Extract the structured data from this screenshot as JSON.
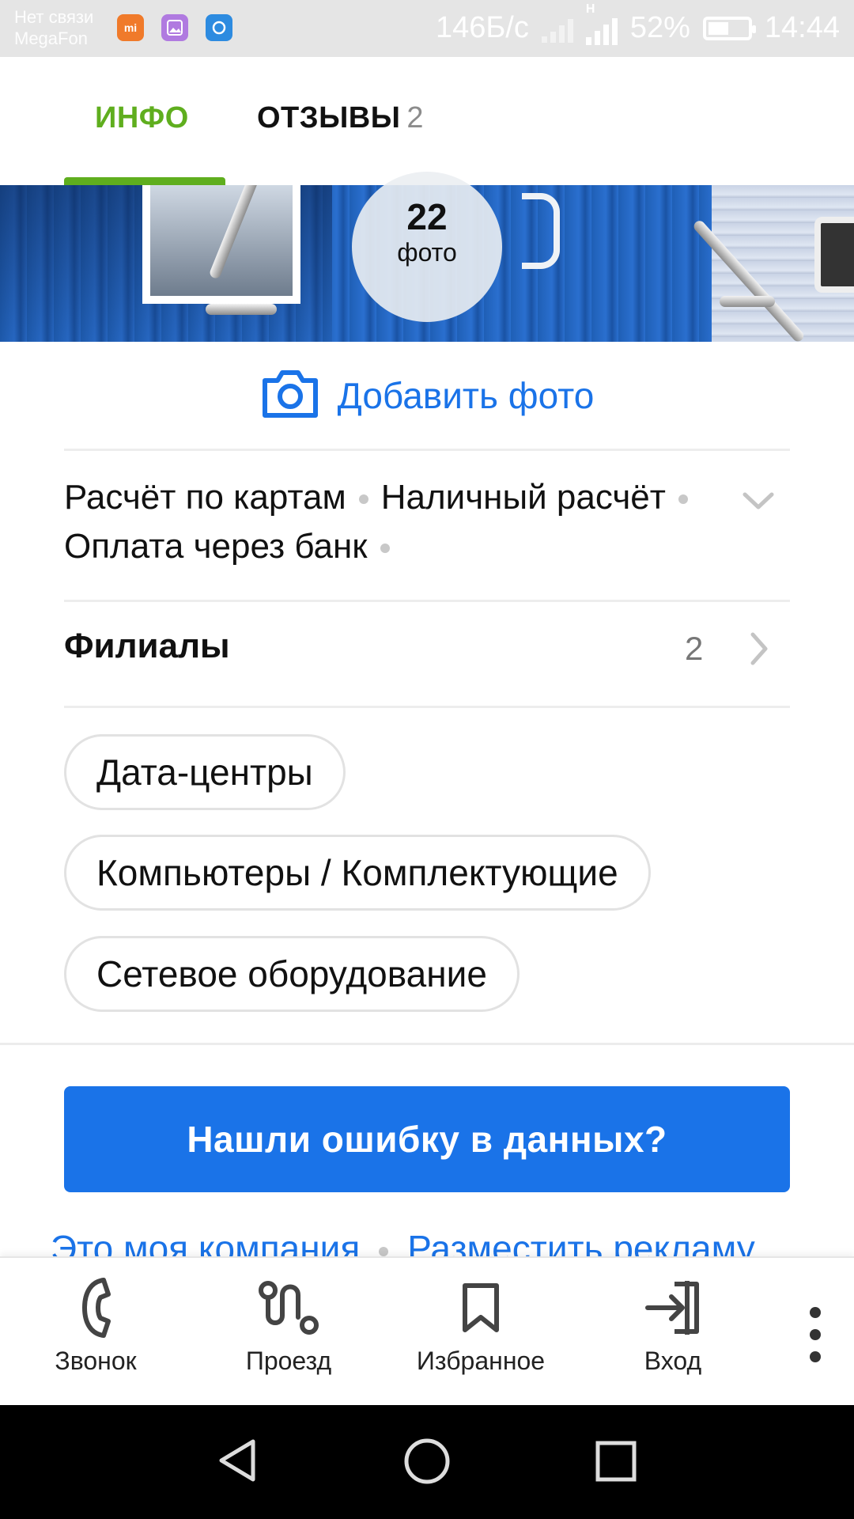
{
  "status_bar": {
    "carrier_line1": "Нет связи",
    "carrier_line2": "MegaFon",
    "net_speed": "146Б/с",
    "network_type": "H",
    "battery_percent": "52%",
    "battery_level": 0.52,
    "time": "14:44",
    "app_icons": [
      "mi-icon",
      "gallery-icon",
      "assistant-icon"
    ]
  },
  "tabs": [
    {
      "label": "ИНФО",
      "active": true
    },
    {
      "label": "ОТЗЫВЫ",
      "count": "2",
      "active": false
    }
  ],
  "photos": {
    "count": "22",
    "count_label": "фото"
  },
  "add_photo": {
    "label": "Добавить фото"
  },
  "payment": {
    "items": [
      "Расчёт по картам",
      "Наличный расчёт",
      "Оплата через банк"
    ]
  },
  "filials": {
    "label": "Филиалы",
    "count": "2"
  },
  "categories": [
    "Дата-центры",
    "Компьютеры / Комплектующие",
    "Сетевое оборудование"
  ],
  "error_button": {
    "label": "Нашли ошибку в данных?"
  },
  "footer_links": [
    "Это моя компания",
    "Разместить рекламу"
  ],
  "toolbar": [
    {
      "label": "Звонок",
      "icon": "phone-icon"
    },
    {
      "label": "Проезд",
      "icon": "route-icon"
    },
    {
      "label": "Избранное",
      "icon": "bookmark-icon"
    },
    {
      "label": "Вход",
      "icon": "login-icon"
    }
  ],
  "colors": {
    "accent_green": "#5fae1e",
    "accent_blue": "#1a73e8"
  }
}
